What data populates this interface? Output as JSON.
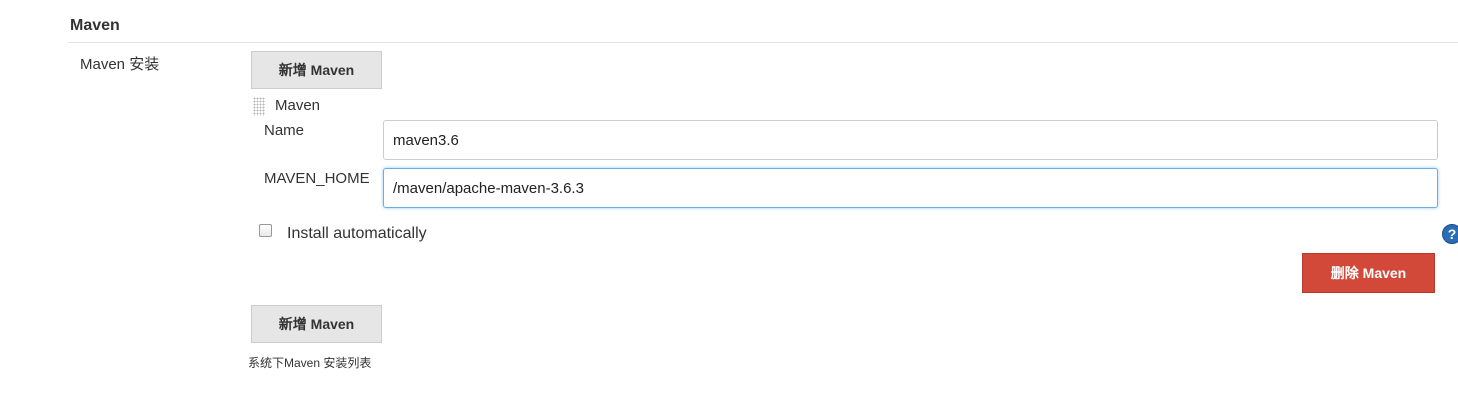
{
  "section": {
    "title": "Maven"
  },
  "maven_installations": {
    "label": "Maven 安装",
    "add_button": "新增 Maven",
    "installation": {
      "title": "Maven",
      "name_label": "Name",
      "name_value": "maven3.6",
      "home_label": "MAVEN_HOME",
      "home_value": "/maven/apache-maven-3.6.3",
      "install_auto_label": "Install automatically",
      "install_auto_checked": false,
      "help_icon": "?",
      "delete_button": "删除 Maven"
    },
    "add_button_bottom": "新增 Maven",
    "description": "系统下Maven 安装列表"
  },
  "colors": {
    "delete_button": "#d24939",
    "focus_border": "#66afe9",
    "help_icon": "#2a6cb5"
  }
}
